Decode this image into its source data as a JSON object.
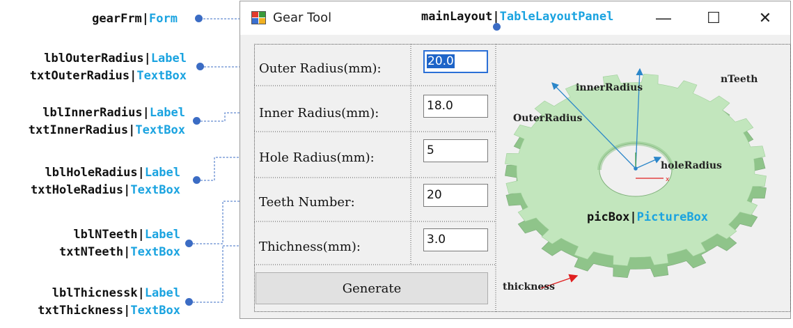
{
  "annotations": {
    "form": {
      "name": "gearFrm",
      "type": "Form"
    },
    "outer": {
      "label_name": "lblOuterRadius",
      "label_type": "Label",
      "box_name": "txtOuterRadius",
      "box_type": "TextBox"
    },
    "inner": {
      "label_name": "lblInnerRadius",
      "label_type": "Label",
      "box_name": "txtInnerRadius",
      "box_type": "TextBox"
    },
    "hole": {
      "label_name": "lblHoleRadius",
      "label_type": "Label",
      "box_name": "txtHoleRadius",
      "box_type": "TextBox"
    },
    "teeth": {
      "label_name": "lblNTeeth",
      "label_type": "Label",
      "box_name": "txtNTeeth",
      "box_type": "TextBox"
    },
    "thick": {
      "label_name": "lblThicnessk",
      "label_type": "Label",
      "box_name": "txtThickness",
      "box_type": "TextBox"
    },
    "layout": {
      "name": "mainLayout",
      "type": "TableLayoutPanel"
    },
    "picture": {
      "name": "picBox",
      "type": "PictureBox"
    },
    "separator": "|"
  },
  "window": {
    "title": "Gear Tool",
    "minimize": "—",
    "maximize": "☐",
    "close": "✕"
  },
  "form": {
    "outer_label": "Outer Radius(mm):",
    "outer_value": "20.0",
    "inner_label": "Inner Radius(mm):",
    "inner_value": "18.0",
    "hole_label": "Hole Radius(mm):",
    "hole_value": "5",
    "teeth_label": "Teeth Number:",
    "teeth_value": "20",
    "thickness_label": "Thichness(mm):",
    "thickness_value": "3.0",
    "generate_label": "Generate"
  },
  "gear_labels": {
    "inner": "innerRadius",
    "outer": "OuterRadius",
    "teeth": "nTeeth",
    "hole": "holeRadius",
    "thickness": "thickness",
    "axis_x": "x"
  },
  "colors": {
    "annotation_type": "#1aa3e0",
    "connector": "#3b6cc4",
    "gear_face": "#c2e6bd",
    "gear_side": "#8fc48a",
    "radius_arrow": "#2b86c9",
    "thickness_arrow": "#e02020"
  }
}
